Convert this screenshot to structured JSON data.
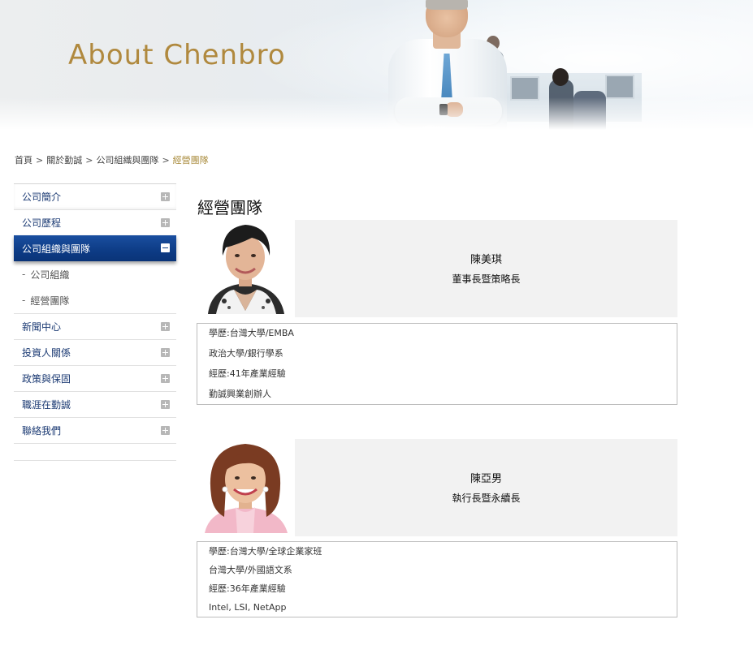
{
  "banner": {
    "title": "About Chenbro"
  },
  "breadcrumb": {
    "items": [
      "首頁",
      "關於勤誠",
      "公司組織與團隊"
    ],
    "separator": ">",
    "current": "經營團隊"
  },
  "sidebar": {
    "items": [
      {
        "label": "公司簡介"
      },
      {
        "label": "公司歷程"
      },
      {
        "label": "公司組織與團隊",
        "active": true,
        "children": [
          "公司組織",
          "經營團隊"
        ]
      },
      {
        "label": "新聞中心"
      },
      {
        "label": "投資人關係"
      },
      {
        "label": "政策與保固"
      },
      {
        "label": "職涯在勤誠"
      },
      {
        "label": "聯絡我們"
      }
    ],
    "sub_dash": "-"
  },
  "main": {
    "title": "經營團隊",
    "members": [
      {
        "name": "陳美琪",
        "position": "董事長暨策略長",
        "details": [
          "學歷:台灣大學/EMBA",
          "政治大學/銀行學系",
          "經歷:41年產業經驗",
          "勤誠興業創辦人"
        ]
      },
      {
        "name": "陳亞男",
        "position": "執行長暨永續長",
        "details": [
          "學歷:台灣大學/全球企業家班",
          "台灣大學/外國語文系",
          "經歷:36年產業經驗",
          "Intel, LSI, NetApp"
        ]
      }
    ]
  },
  "colors": {
    "accent_gold": "#b0893e",
    "nav_active": "#0d3b85",
    "nav_text": "#1b3a73"
  }
}
